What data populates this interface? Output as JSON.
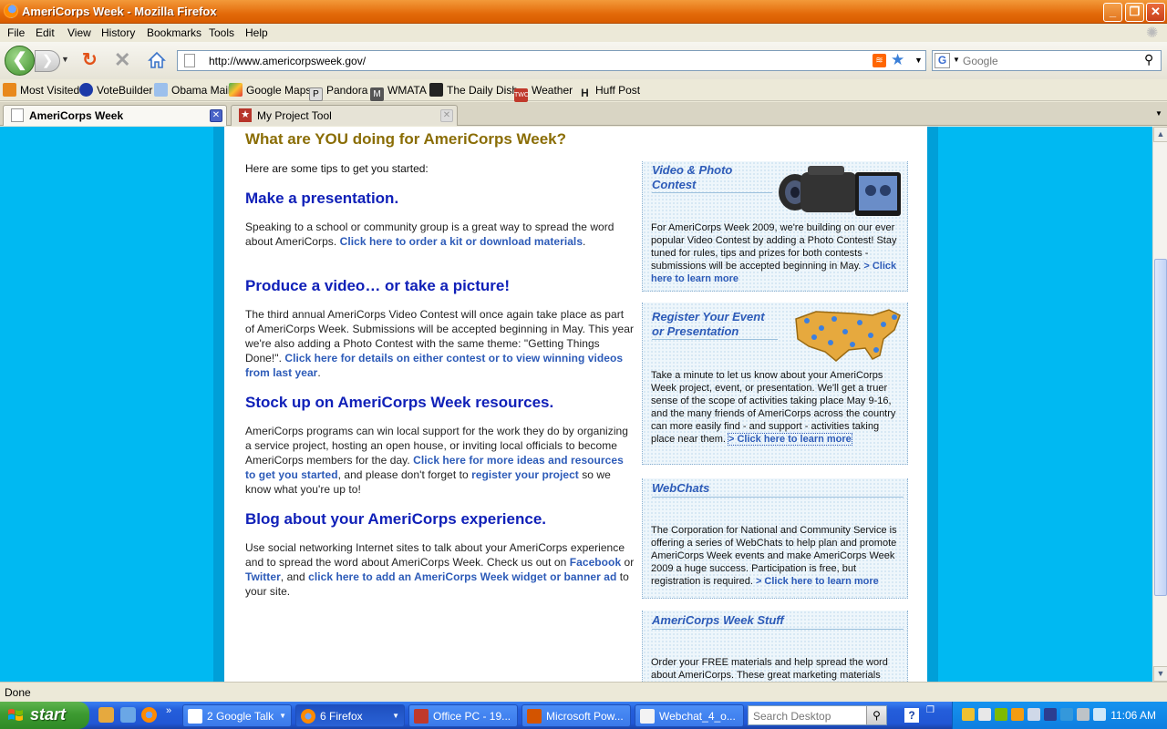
{
  "window": {
    "title": "AmeriCorps Week - Mozilla Firefox"
  },
  "menu": [
    "File",
    "Edit",
    "View",
    "History",
    "Bookmarks",
    "Tools",
    "Help"
  ],
  "nav": {
    "url": "http://www.americorpsweek.gov/",
    "search_placeholder": "Google"
  },
  "bookmarks": [
    "Most Visited",
    "VoteBuilder",
    "Obama Mail",
    "Google Maps",
    "Pandora",
    "WMATA",
    "The Daily Dish",
    "Weather",
    "Huff Post"
  ],
  "tabs": [
    {
      "label": "AmeriCorps Week"
    },
    {
      "label": "My Project Tool"
    }
  ],
  "page": {
    "heading": "What are YOU doing for AmeriCorps Week?",
    "intro": "Here are some tips to get you started:",
    "sections": [
      {
        "title": "Make a presentation.",
        "text1": "Speaking to a school or community group is a great way to spread the word about AmeriCorps. ",
        "link1": "Click here to order a kit or download materials",
        "text2": "."
      },
      {
        "title": "Produce a video… or take a picture!",
        "text1": "The third annual AmeriCorps Video Contest will once again take place as part of AmeriCorps Week. Submissions will be accepted beginning in May. This year we're also adding a Photo Contest with the same theme: \"Getting Things Done!\".  ",
        "link1": "Click here for details on either contest or to view winning videos from last year",
        "text2": "."
      },
      {
        "title": "Stock up on AmeriCorps Week resources.",
        "text1": "AmeriCorps programs can win local support for the work they do by organizing a service project, hosting an open house, or inviting local officials to become AmeriCorps members for the day.  ",
        "link1": "Click here for more ideas and resources to get you started",
        "text2": ", and please don't forget to ",
        "link2": "register your project",
        "text3": " so we know what you're up to!"
      },
      {
        "title": "Blog about your AmeriCorps experience.",
        "text1": "Use social networking Internet sites to talk about your AmeriCorps experience and to spread the word about AmeriCorps Week.  Check us out on ",
        "link1": "Facebook",
        "text2": " or ",
        "link2": "Twitter",
        "text3": ", and ",
        "link3": "click here to add an AmeriCorps Week widget or banner ad",
        "text4": " to your site."
      }
    ],
    "sidebar": [
      {
        "title_line1": "Video & Photo",
        "title_line2": "Contest",
        "text": "For AmeriCorps Week 2009, we're building on our ever popular Video Contest by adding a Photo Contest!  Stay tuned for rules, tips and prizes for both contests - submissions will be accepted beginning in May.  ",
        "link": "> Click here to learn more"
      },
      {
        "title_line1": "Register Your Event",
        "title_line2": "or Presentation",
        "text": "Take a minute to let us know about your AmeriCorps Week project, event, or presentation. We'll get a truer sense of the scope of activities taking place May 9-16, and the many friends of AmeriCorps across the country can more easily find - and support - activities taking place near them. ",
        "link": "> Click here to learn more"
      },
      {
        "title_line1": "WebChats",
        "text": "The Corporation for National and Community Service is offering a series of WebChats to help plan and promote AmeriCorps Week events and make AmeriCorps Week 2009 a huge success.  Participation is free, but registration is required.  ",
        "link": "> Click here to learn more"
      },
      {
        "title_line1": "AmeriCorps Week Stuff",
        "text": "Order your FREE materials and help spread the word about AmeriCorps. These great marketing materials"
      }
    ]
  },
  "status": "Done",
  "taskbar": {
    "start": "start",
    "tasks": [
      "2 Google Talk",
      "6 Firefox",
      "Office PC - 19...",
      "Microsoft Pow...",
      "Webchat_4_o..."
    ],
    "desktop_search": "Search Desktop",
    "clock": "11:06 AM"
  },
  "colors": {
    "page_bg": "#00b9f2",
    "heading_gold": "#8a6d05",
    "section_blue": "#1020b8",
    "link_blue": "#2d5bb8"
  }
}
